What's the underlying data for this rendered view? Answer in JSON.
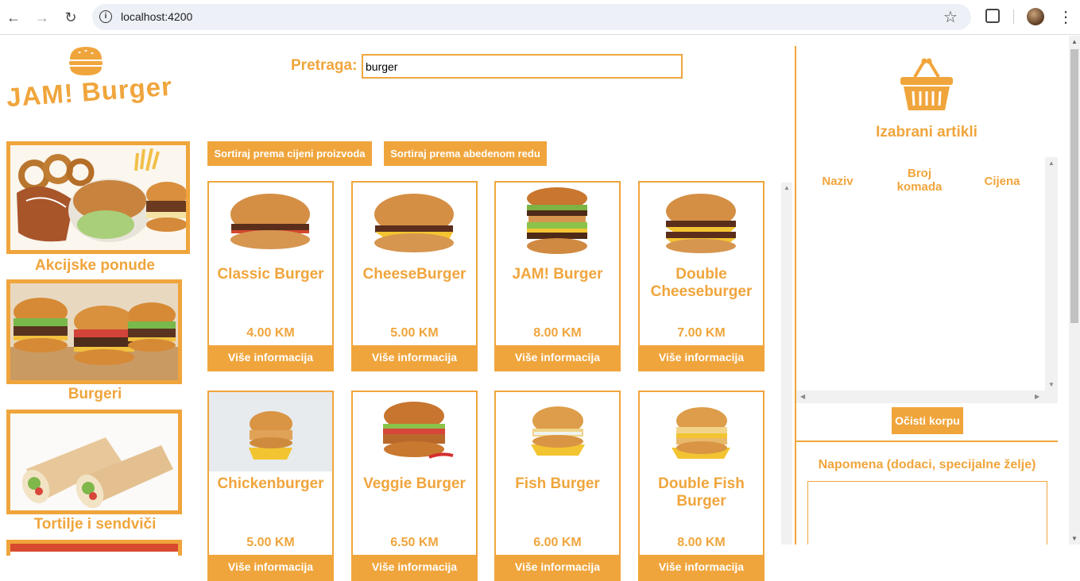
{
  "browser": {
    "url": "localhost:4200",
    "back_icon": "←",
    "forward_icon": "→",
    "reload_icon": "↻",
    "info_icon": "i",
    "star_icon": "☆",
    "menu_icon": "⋮"
  },
  "brand": {
    "name": "JAM! Burger"
  },
  "search": {
    "label": "Pretraga:",
    "value": "burger"
  },
  "categories": [
    {
      "label": "Akcijske ponude"
    },
    {
      "label": "Burgeri"
    },
    {
      "label": "Tortilje i sendviči"
    }
  ],
  "sort": {
    "by_price": "Sortiraj prema cijeni proizvoda",
    "by_alpha": "Sortiraj prema abedenom redu"
  },
  "products": [
    {
      "name": "Classic Burger",
      "price": "4.00 KM",
      "button": "Više informacija"
    },
    {
      "name": "CheeseBurger",
      "price": "5.00 KM",
      "button": "Više informacija"
    },
    {
      "name": "JAM! Burger",
      "price": "8.00 KM",
      "button": "Više informacija"
    },
    {
      "name": "Double Cheeseburger",
      "price": "7.00 KM",
      "button": "Više informacija"
    },
    {
      "name": "Chickenburger",
      "price": "5.00 KM",
      "button": "Više informacija"
    },
    {
      "name": "Veggie Burger",
      "price": "6.50 KM",
      "button": "Više informacija"
    },
    {
      "name": "Fish Burger",
      "price": "6.00 KM",
      "button": "Više informacija"
    },
    {
      "name": "Double Fish Burger",
      "price": "8.00 KM",
      "button": "Više informacija"
    }
  ],
  "cart": {
    "title": "Izabrani artikli",
    "columns": [
      "Naziv",
      "Broj komada",
      "Cijena"
    ],
    "clear_button": "Očisti korpu",
    "note_label": "Napomena (dodaci, specijalne želje)"
  },
  "colors": {
    "accent": "#f0a53c"
  }
}
